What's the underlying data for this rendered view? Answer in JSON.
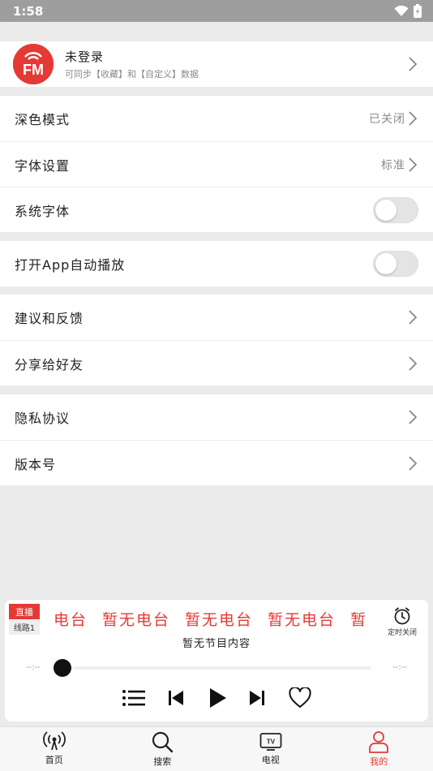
{
  "status": {
    "time": "1:58"
  },
  "profile": {
    "avatar_text": "FM",
    "name": "未登录",
    "subtitle": "可同步【收藏】和【自定义】数据"
  },
  "settings": {
    "dark_mode": {
      "label": "深色模式",
      "value": "已关闭"
    },
    "font_settings": {
      "label": "字体设置",
      "value": "标准"
    },
    "system_font": {
      "label": "系统字体",
      "enabled": false
    },
    "autoplay": {
      "label": "打开App自动播放",
      "enabled": false
    },
    "feedback": {
      "label": "建议和反馈"
    },
    "share": {
      "label": "分享给好友"
    },
    "privacy": {
      "label": "隐私协议"
    },
    "version": {
      "label": "版本号"
    }
  },
  "player": {
    "live_label": "直播",
    "line_label": "线路1",
    "marquee": [
      "电台",
      "暂无电台",
      "暂无电台",
      "暂无电台",
      "暂"
    ],
    "timer_label": "定时关闭",
    "program": "暂无节目内容",
    "time_start": "--:--",
    "time_end": "--:--",
    "progress": 0
  },
  "nav": {
    "items": [
      {
        "label": "首页",
        "icon": "radio-antenna-icon"
      },
      {
        "label": "搜索",
        "icon": "search-icon"
      },
      {
        "label": "电视",
        "icon": "tv-icon"
      },
      {
        "label": "我的",
        "icon": "user-icon"
      }
    ],
    "active": "我的",
    "accent": "#e53935"
  }
}
